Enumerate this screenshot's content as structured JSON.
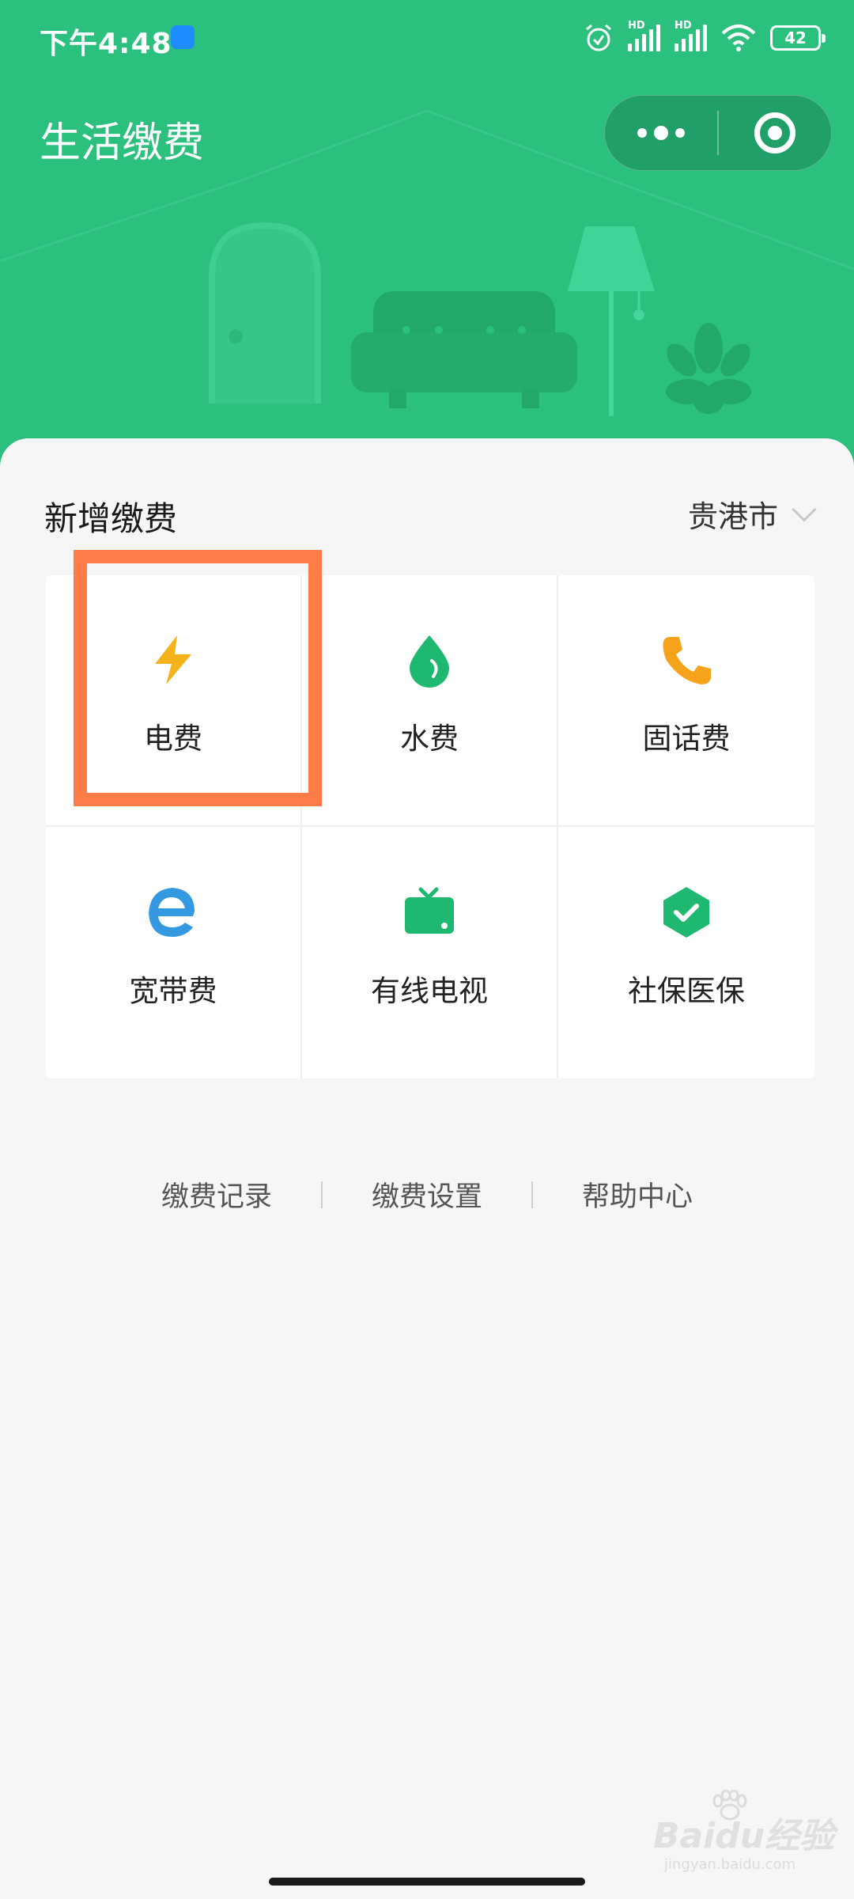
{
  "status_bar": {
    "time": "下午4:48",
    "battery": "42",
    "signal_label": "HD"
  },
  "header": {
    "title": "生活缴费",
    "capsule": {
      "more_icon": "more-dots-icon",
      "close_icon": "mini-program-close-icon"
    }
  },
  "main": {
    "section_title": "新增缴费",
    "city": "贵港市",
    "services": [
      {
        "label": "电费",
        "icon": "lightning-icon",
        "color": "#f5b21b"
      },
      {
        "label": "水费",
        "icon": "water-drop-icon",
        "color": "#1fb870"
      },
      {
        "label": "固话费",
        "icon": "phone-icon",
        "color": "#f5a31b"
      },
      {
        "label": "宽带费",
        "icon": "broadband-e-icon",
        "color": "#3499e0"
      },
      {
        "label": "有线电视",
        "icon": "tv-icon",
        "color": "#1fb870"
      },
      {
        "label": "社保医保",
        "icon": "shield-check-icon",
        "color": "#1fb870"
      }
    ],
    "links": [
      "缴费记录",
      "缴费设置",
      "帮助中心"
    ]
  },
  "watermark": {
    "main": "Baidu经验",
    "sub": "jingyan.baidu.com"
  },
  "colors": {
    "header_green": "#2cc07f",
    "highlight": "#ff7b47"
  }
}
